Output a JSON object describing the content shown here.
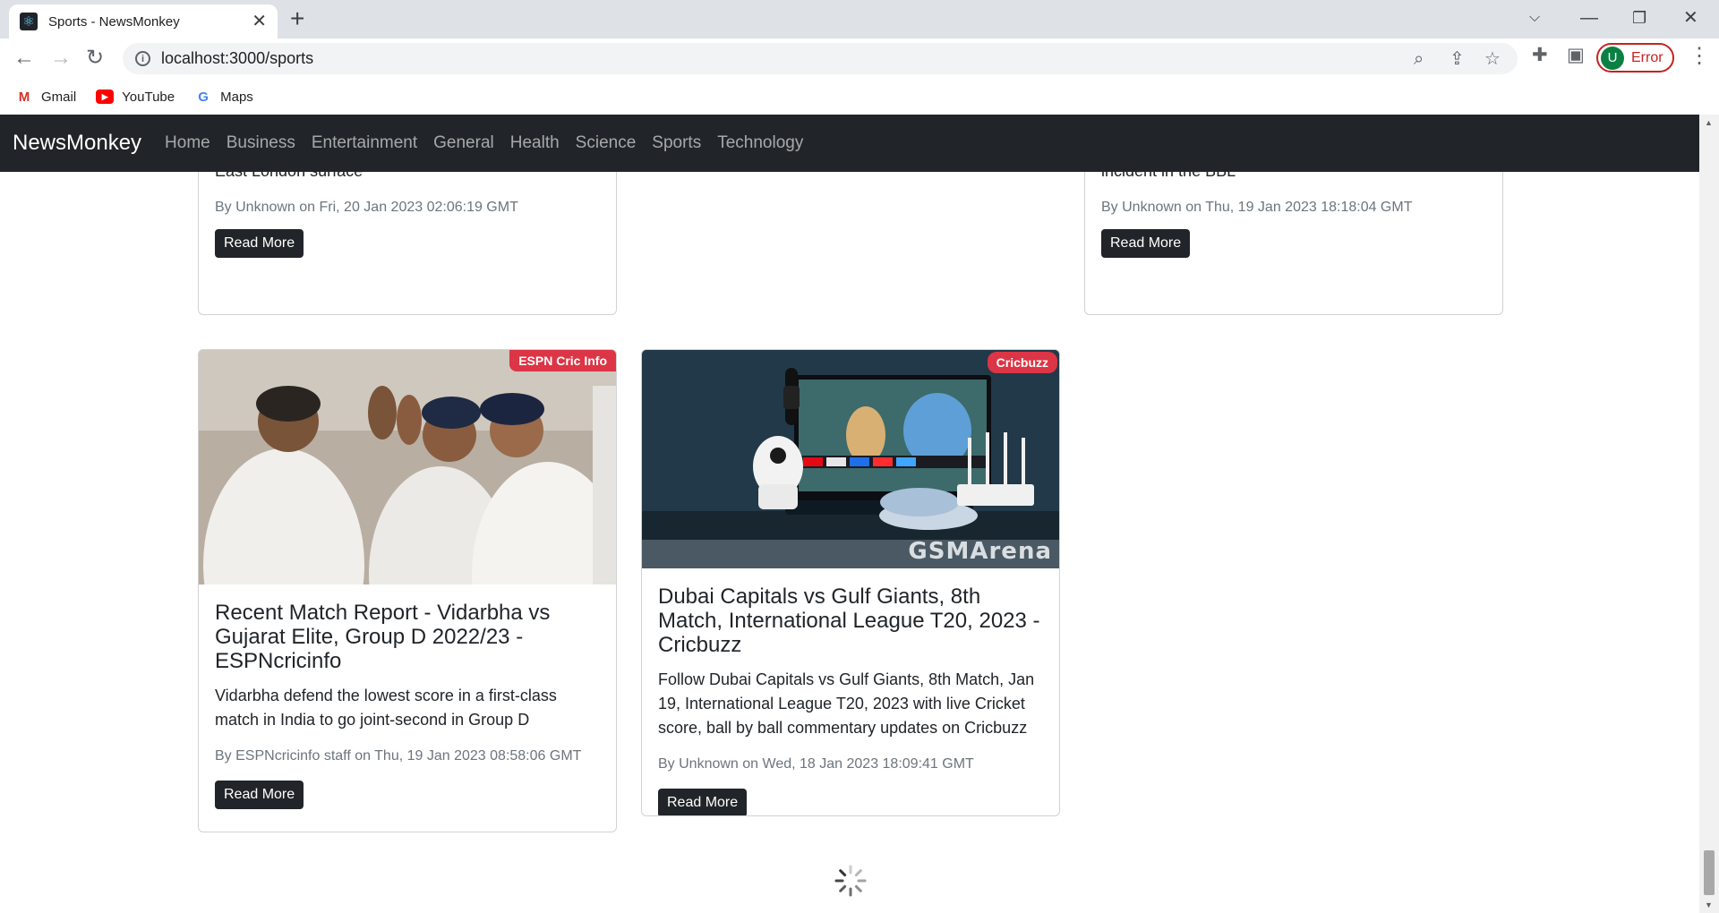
{
  "browser": {
    "tab_title": "Sports - NewsMonkey",
    "url": "localhost:3000/sports",
    "profile_initial": "U",
    "profile_status": "Error",
    "bookmarks": [
      {
        "label": "Gmail",
        "icon": "gmail-icon"
      },
      {
        "label": "YouTube",
        "icon": "youtube-icon"
      },
      {
        "label": "Maps",
        "icon": "google-maps-icon"
      }
    ]
  },
  "navbar": {
    "brand": "NewsMonkey",
    "links": [
      "Home",
      "Business",
      "Entertainment",
      "General",
      "Health",
      "Science",
      "Sports",
      "Technology"
    ]
  },
  "articles": [
    {
      "text": "defended their competitive score on a slow and dry East London surface",
      "meta": "By Unknown on Fri, 20 Jan 2023 02:06:19 GMT",
      "button": "Read More"
    },
    {
      "text": "confusion caused by the Adam Zampa-Tom Rogers incident in the BBL",
      "meta": "By Unknown on Thu, 19 Jan 2023 18:18:04 GMT",
      "button": "Read More"
    },
    {
      "source": "ESPN Cric Info",
      "title": "Recent Match Report - Vidarbha vs Gujarat Elite, Group D 2022/23 - ESPNcricinfo",
      "text": "Vidarbha defend the lowest score in a first-class match in India to go joint-second in Group D",
      "meta": "By ESPNcricinfo staff on Thu, 19 Jan 2023 08:58:06 GMT",
      "button": "Read More"
    },
    {
      "source": "Cricbuzz",
      "image_watermark": "GSMArena",
      "title": "Dubai Capitals vs Gulf Giants, 8th Match, International League T20, 2023 - Cricbuzz",
      "text": "Follow Dubai Capitals vs Gulf Giants, 8th Match, Jan 19, International League T20, 2023 with live Cricket score, ball by ball commentary updates on Cricbuzz",
      "meta": "By Unknown on Wed, 18 Jan 2023 18:09:41 GMT",
      "button": "Read More"
    }
  ],
  "colors": {
    "navbar_bg": "#212529",
    "badge_bg": "#dc3545",
    "button_bg": "#212529"
  }
}
